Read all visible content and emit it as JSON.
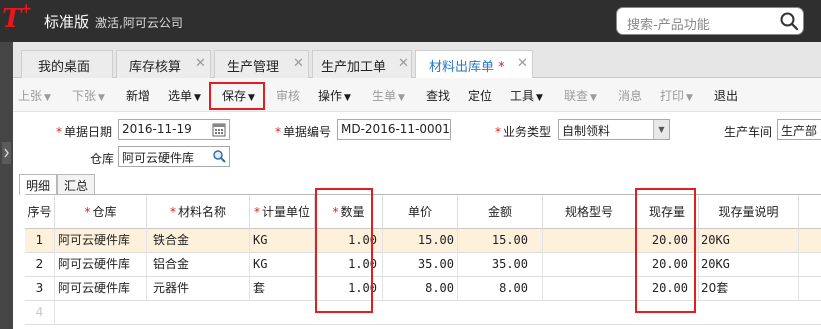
{
  "app": {
    "logo": "T",
    "logo_plus": "+",
    "edition": "标准版",
    "company": "激活,阿可云公司",
    "search_placeholder": "搜索-产品功能"
  },
  "tabs": [
    {
      "label": "我的桌面",
      "closable": false
    },
    {
      "label": "库存核算",
      "closable": true
    },
    {
      "label": "生产管理",
      "closable": true
    },
    {
      "label": "生产加工单",
      "closable": true
    },
    {
      "label": "材料出库单",
      "closable": true,
      "active": true,
      "modified_mark": "*"
    }
  ],
  "toolbar": [
    {
      "label": "上张",
      "caret": true,
      "enabled": false
    },
    {
      "label": "下张",
      "caret": true,
      "enabled": false
    },
    {
      "label": "新增",
      "caret": false,
      "enabled": true
    },
    {
      "label": "选单",
      "caret": true,
      "enabled": true
    },
    {
      "label": "保存",
      "caret": true,
      "enabled": true,
      "highlighted": true
    },
    {
      "label": "审核",
      "caret": false,
      "enabled": false
    },
    {
      "label": "操作",
      "caret": true,
      "enabled": true
    },
    {
      "label": "生单",
      "caret": true,
      "enabled": false
    },
    {
      "label": "查找",
      "caret": false,
      "enabled": true
    },
    {
      "label": "定位",
      "caret": false,
      "enabled": true
    },
    {
      "label": "工具",
      "caret": true,
      "enabled": true
    },
    {
      "label": "联查",
      "caret": true,
      "enabled": false
    },
    {
      "label": "消息",
      "caret": false,
      "enabled": false
    },
    {
      "label": "打印",
      "caret": true,
      "enabled": false
    },
    {
      "label": "退出",
      "caret": false,
      "enabled": true
    }
  ],
  "form": {
    "doc_date_label": "单据日期",
    "doc_date": "2016-11-19",
    "doc_no_label": "单据编号",
    "doc_no": "MD-2016-11-0001",
    "biz_type_label": "业务类型",
    "biz_type": "自制领料",
    "workshop_label": "生产车间",
    "workshop": "生产部",
    "warehouse_label": "仓库",
    "warehouse": "阿可云硬件库",
    "required_mark": "*"
  },
  "subtabs": [
    "明细",
    "汇总"
  ],
  "grid": {
    "headers": [
      "序号",
      "仓库",
      "材料名称",
      "计量单位",
      "数量",
      "单价",
      "金额",
      "规格型号",
      "现存量",
      "现存量说明"
    ],
    "rows": [
      {
        "no": "1",
        "warehouse": "阿可云硬件库",
        "material": "铁合金",
        "unit": "KG",
        "qty": "1.00",
        "price": "15.00",
        "amount": "15.00",
        "spec": "",
        "stock": "20.00",
        "stock_note": "20KG"
      },
      {
        "no": "2",
        "warehouse": "阿可云硬件库",
        "material": "铝合金",
        "unit": "KG",
        "qty": "1.00",
        "price": "35.00",
        "amount": "35.00",
        "spec": "",
        "stock": "20.00",
        "stock_note": "20KG"
      },
      {
        "no": "3",
        "warehouse": "阿可云硬件库",
        "material": "元器件",
        "unit": "套",
        "qty": "1.00",
        "price": "8.00",
        "amount": "8.00",
        "spec": "",
        "stock": "20.00",
        "stock_note": "20套"
      }
    ],
    "next_row_no": "4"
  },
  "colors": {
    "header_bg": "#2f2f2f",
    "logo_red": "#e8171b",
    "highlight_red": "#e02020",
    "active_tab_text": "#2b79c8",
    "selected_row": "#fdf1dc"
  }
}
